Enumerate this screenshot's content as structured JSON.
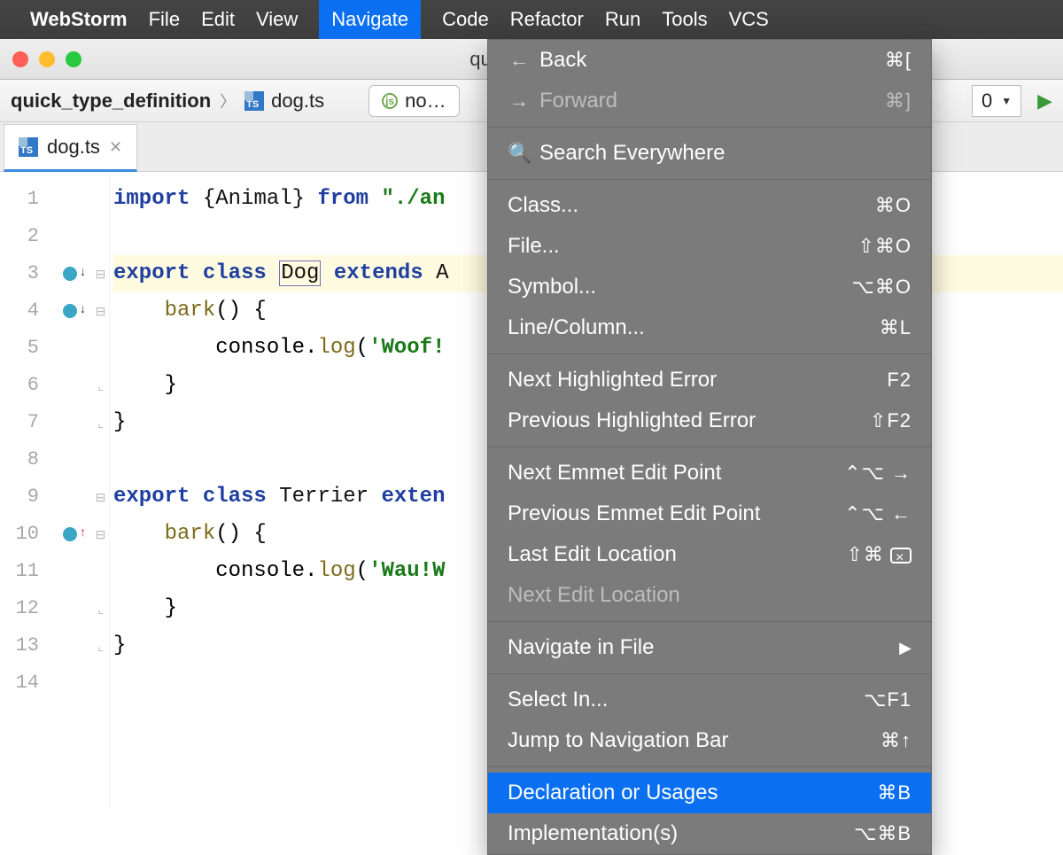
{
  "menubar": {
    "app": "WebStorm",
    "items": [
      "File",
      "Edit",
      "View",
      "Navigate",
      "Code",
      "Refactor",
      "Run",
      "Tools",
      "VCS"
    ],
    "active_index": 3
  },
  "window_title": "quick_type_…",
  "breadcrumb": {
    "project": "quick_type_definition",
    "file": "dog.ts"
  },
  "node_pill": "no…",
  "config_select": "0",
  "tab": {
    "label": "dog.ts"
  },
  "gutter_lines": [
    "1",
    "2",
    "3",
    "4",
    "5",
    "6",
    "7",
    "8",
    "9",
    "10",
    "11",
    "12",
    "13",
    "14"
  ],
  "code": {
    "l1": {
      "a": "import ",
      "b": "{Animal} ",
      "c": "from ",
      "d": "\"./an"
    },
    "l3": {
      "a": "export class ",
      "b": "Dog",
      "c": " extends ",
      "d": "A"
    },
    "l4": {
      "a": "    ",
      "b": "bark",
      "c": "() {"
    },
    "l5": {
      "a": "        console.",
      "b": "log",
      "c": "(",
      "d": "'Woof!"
    },
    "l6": "    }",
    "l7": "}",
    "l9": {
      "a": "export class ",
      "b": "Terrier ",
      "c": "exten"
    },
    "l10": {
      "a": "    ",
      "b": "bark",
      "c": "() {"
    },
    "l11": {
      "a": "        console.",
      "b": "log",
      "c": "(",
      "d": "'Wau!W"
    },
    "l12": "    }",
    "l13": "}"
  },
  "menu": {
    "back": {
      "label": "Back",
      "shortcut": "⌘["
    },
    "forward": {
      "label": "Forward",
      "shortcut": "⌘]"
    },
    "search": "Search Everywhere",
    "class": {
      "label": "Class...",
      "shortcut": "⌘O"
    },
    "file": {
      "label": "File...",
      "shortcut": "⇧⌘O"
    },
    "symbol": {
      "label": "Symbol...",
      "shortcut": "⌥⌘O"
    },
    "line": {
      "label": "Line/Column...",
      "shortcut": "⌘L"
    },
    "nexterr": {
      "label": "Next Highlighted Error",
      "shortcut": "F2"
    },
    "preverr": {
      "label": "Previous Highlighted Error",
      "shortcut": "⇧F2"
    },
    "nextemmet": {
      "label": "Next Emmet Edit Point",
      "shortcut": "⌃⌥ →"
    },
    "prevemmet": {
      "label": "Previous Emmet Edit Point",
      "shortcut": "⌃⌥ ←"
    },
    "lastedit": {
      "label": "Last Edit Location",
      "shortcut": "⇧⌘"
    },
    "nextedit": {
      "label": "Next Edit Location"
    },
    "navfile": {
      "label": "Navigate in File"
    },
    "selectin": {
      "label": "Select In...",
      "shortcut": "⌥F1"
    },
    "jumpnav": {
      "label": "Jump to Navigation Bar",
      "shortcut": "⌘↑"
    },
    "decl": {
      "label": "Declaration or Usages",
      "shortcut": "⌘B"
    },
    "impl": {
      "label": "Implementation(s)",
      "shortcut": "⌥⌘B"
    }
  }
}
